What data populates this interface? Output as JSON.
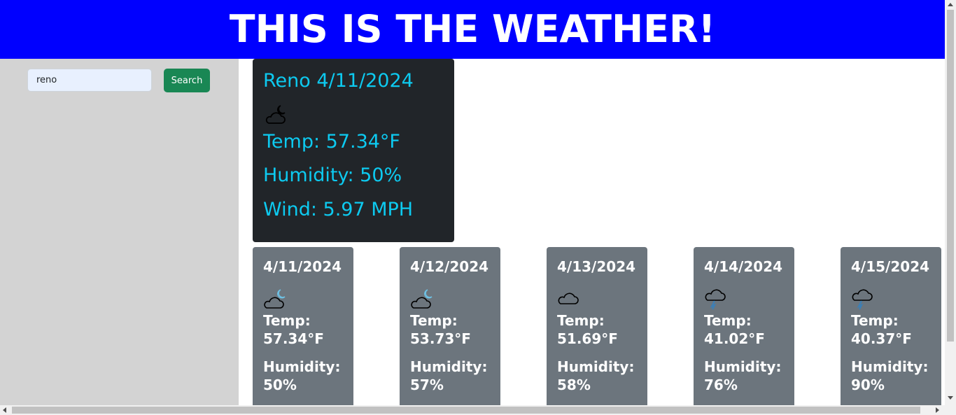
{
  "header": {
    "title": "THIS IS THE WEATHER!"
  },
  "search": {
    "value": "reno",
    "button_label": "Search"
  },
  "current": {
    "title": "Reno 4/11/2024",
    "icon": "night-cloud-icon",
    "temp": "Temp: 57.34°F",
    "humidity": "Humidity: 50%",
    "wind": "Wind: 5.97 MPH"
  },
  "forecast": [
    {
      "date": "4/11/2024",
      "icon": "night-cloud-icon",
      "temp_label": "Temp:",
      "temp": "57.34°F",
      "humidity_label": "Humidity:",
      "humidity": "50%"
    },
    {
      "date": "4/12/2024",
      "icon": "night-cloud-icon",
      "temp_label": "Temp:",
      "temp": "53.73°F",
      "humidity_label": "Humidity:",
      "humidity": "57%"
    },
    {
      "date": "4/13/2024",
      "icon": "cloud-icon",
      "temp_label": "Temp:",
      "temp": "51.69°F",
      "humidity_label": "Humidity:",
      "humidity": "58%"
    },
    {
      "date": "4/14/2024",
      "icon": "rain-cloud-icon",
      "temp_label": "Temp:",
      "temp": "41.02°F",
      "humidity_label": "Humidity:",
      "humidity": "76%"
    },
    {
      "date": "4/15/2024",
      "icon": "rain-cloud-icon",
      "temp_label": "Temp:",
      "temp": "40.37°F",
      "humidity_label": "Humidity:",
      "humidity": "90%"
    }
  ],
  "colors": {
    "header_bg": "#0000ff",
    "sidebar_bg": "#d3d3d3",
    "current_bg": "#212529",
    "current_text": "#0dcaf0",
    "card_bg": "#6c757d",
    "button_bg": "#198754"
  }
}
